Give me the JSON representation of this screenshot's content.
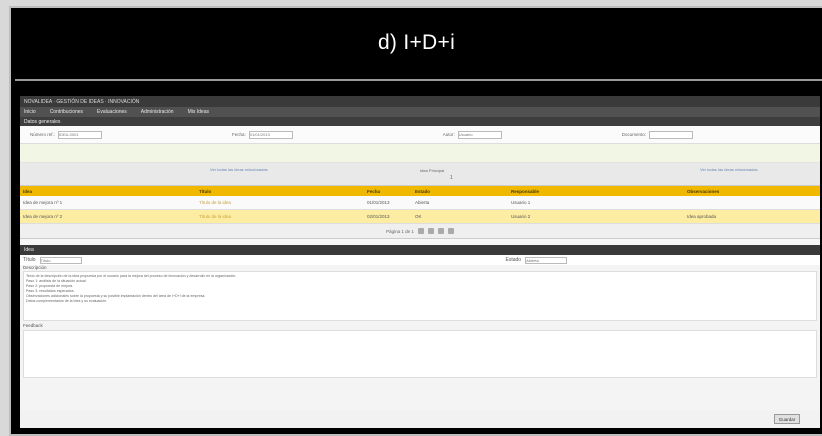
{
  "caption": "d) I+D+i",
  "app": {
    "title": "NOVALIDEA · GESTIÓN DE IDEAS · INNOVACIÓN",
    "menu": [
      "Inicio",
      "Contribuciones",
      "Evaluaciones",
      "Administración",
      "Mis Ideas"
    ],
    "section_title": "Datos generales",
    "fields": [
      {
        "label": "Número ref.:",
        "value": "IDEA-0001"
      },
      {
        "label": "Fecha:",
        "value": "01/01/2013"
      },
      {
        "label": "Autor:",
        "value": "Usuario"
      },
      {
        "label": "Documento:",
        "value": ""
      }
    ],
    "links": {
      "left": "Ver todas las ideas relacionadas",
      "right": "Ver todas las ideas relacionadas",
      "center": "Idea Principal",
      "center_num": "1"
    },
    "table": {
      "headers": [
        "Idea",
        "Título",
        "Fecha",
        "Estado",
        "Responsable",
        "Observaciones"
      ],
      "rows": [
        {
          "cells": [
            "Idea de mejora nº 1",
            "Título de la idea",
            "01/01/2013",
            "Abierta",
            "Usuario 1",
            ""
          ],
          "highlight": false
        },
        {
          "cells": [
            "Idea de mejora nº 2",
            "Título de la idea",
            "02/01/2013",
            "OK",
            "Usuario 2",
            "Idea aprobada"
          ],
          "highlight": true
        }
      ]
    },
    "pager": {
      "label": "Página 1 de 1"
    },
    "idea_section": "Idea",
    "title_label": "Título",
    "title_value": "Título",
    "status_label": "Estado",
    "status_value": "Abierta",
    "description_label": "Descripción",
    "description_lines": [
      "Texto de la descripción de la idea propuesta por el usuario para la mejora del proceso de innovación y desarrollo en la organización.",
      " ",
      "Paso 1: análisis de la situación actual.",
      "Paso 2: propuesta de mejora.",
      "Paso 3: resultados esperados.",
      " ",
      "Observaciones adicionales sobre la propuesta y su posible implantación dentro del área de I+D+i de la empresa.",
      "Datos complementarios de la idea y su evaluación."
    ],
    "feedback_label": "Feedback",
    "save_label": "Guardar"
  }
}
